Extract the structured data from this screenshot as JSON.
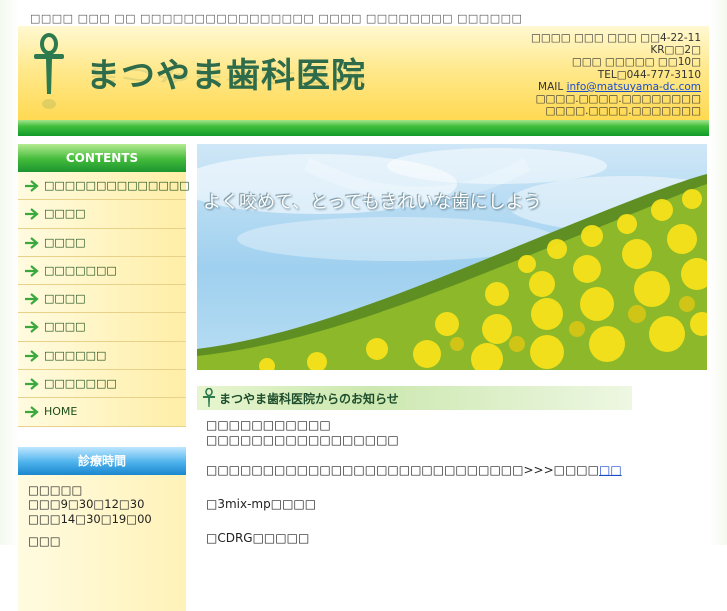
{
  "tagline": "□□□□ □□□ □□ □□□□□□□□□□□□□□□□ □□□□ □□□□□□□□ □□□□□□",
  "site": {
    "logo_text": "まつやま歯科医院"
  },
  "address": {
    "line1": "□□□□ □□□ □□□ □□4-22-11",
    "line2": "KR□□2□",
    "line3": "□□□ □□□□□ □□10□",
    "tel": "TEL□044-777-3110",
    "mail_label": "MAIL",
    "mail": "info@matsuyama-dc.com",
    "line6": "□□□□.□□□□.□□□□□□□□",
    "line7": "□□□□.□□□□.□□□□□□□"
  },
  "sidebar": {
    "contents_title": "CONTENTS",
    "items": [
      {
        "label": "□□□□□□□□□□□□□□"
      },
      {
        "label": "□□□□"
      },
      {
        "label": "□□□□"
      },
      {
        "label": "□□□□□□□"
      },
      {
        "label": "□□□□"
      },
      {
        "label": "□□□□"
      },
      {
        "label": "□□□□□□"
      },
      {
        "label": "□□□□□□□"
      },
      {
        "label": "HOME"
      }
    ],
    "hours_title": "診療時間",
    "hours": {
      "line1": "□□□□□",
      "line2": "□□□9□30□12□30",
      "line3": "□□□14□30□19□00",
      "line4": "□□□"
    }
  },
  "hero": {
    "slogan": "よく咬めて、とってもきれいな歯にしよう"
  },
  "news": {
    "title": "まつやま歯科医院からのお知らせ",
    "line1": "□□□□□□□□□□□",
    "line2": "□□□□□□□□□□□□□□□□□",
    "line3_text": "□□□□□□□□□□□□□□□□□□□□□□□□□□□□>>>□□□□",
    "line3_link": "□□",
    "line4": "□3mix-mp□□□□",
    "line5": "□CDRG□□□□□"
  },
  "colors": {
    "header_yellow": "#ffe98e",
    "bar_green": "#3fbf3c",
    "logo_green": "#2d6b4a",
    "hours_blue": "#4db2ec",
    "link_blue": "#1a4dcc"
  }
}
